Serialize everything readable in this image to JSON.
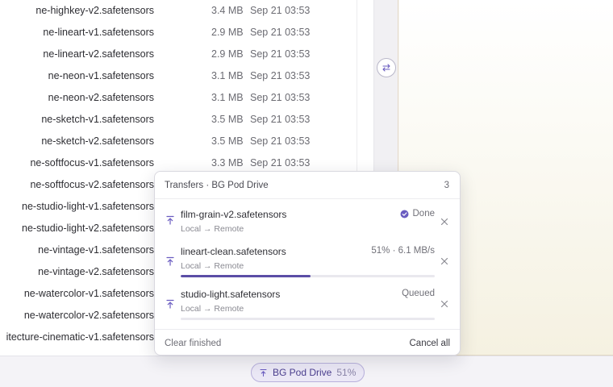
{
  "files": [
    {
      "name": "ne-highkey-v2.safetensors",
      "size": "3.4 MB",
      "date": "Sep 21 03:53"
    },
    {
      "name": "ne-lineart-v1.safetensors",
      "size": "2.9 MB",
      "date": "Sep 21 03:53"
    },
    {
      "name": "ne-lineart-v2.safetensors",
      "size": "2.9 MB",
      "date": "Sep 21 03:53"
    },
    {
      "name": "ne-neon-v1.safetensors",
      "size": "3.1 MB",
      "date": "Sep 21 03:53"
    },
    {
      "name": "ne-neon-v2.safetensors",
      "size": "3.1 MB",
      "date": "Sep 21 03:53"
    },
    {
      "name": "ne-sketch-v1.safetensors",
      "size": "3.5 MB",
      "date": "Sep 21 03:53"
    },
    {
      "name": "ne-sketch-v2.safetensors",
      "size": "3.5 MB",
      "date": "Sep 21 03:53"
    },
    {
      "name": "ne-softfocus-v1.safetensors",
      "size": "3.3 MB",
      "date": "Sep 21 03:53"
    },
    {
      "name": "ne-softfocus-v2.safetensors",
      "size": "",
      "date": ""
    },
    {
      "name": "ne-studio-light-v1.safetensors",
      "size": "",
      "date": ""
    },
    {
      "name": "ne-studio-light-v2.safetensors",
      "size": "",
      "date": ""
    },
    {
      "name": "ne-vintage-v1.safetensors",
      "size": "",
      "date": ""
    },
    {
      "name": "ne-vintage-v2.safetensors",
      "size": "",
      "date": ""
    },
    {
      "name": "ne-watercolor-v1.safetensors",
      "size": "",
      "date": ""
    },
    {
      "name": "ne-watercolor-v2.safetensors",
      "size": "",
      "date": ""
    },
    {
      "name": "itecture-cinematic-v1.safetensors",
      "size": "",
      "date": ""
    }
  ],
  "transfers": {
    "title": "Transfers · BG Pod Drive",
    "count": "3",
    "items": [
      {
        "name": "film-grain-v2.safetensors",
        "route": "Local → Remote",
        "status": "Done",
        "done": true,
        "progress": null
      },
      {
        "name": "lineart-clean.safetensors",
        "route": "Local → Remote",
        "status": "51% · 6.1 MB/s",
        "done": false,
        "progress": 0.51
      },
      {
        "name": "studio-light.safetensors",
        "route": "Local → Remote",
        "status": "Queued",
        "done": false,
        "progress": 0
      }
    ],
    "clear_label": "Clear finished",
    "cancel_label": "Cancel all"
  },
  "status_pill": {
    "label": "BG Pod Drive",
    "percent": "51%"
  },
  "colors": {
    "accent": "#5b4ea6",
    "accent_light": "#ebe8f6",
    "done_badge": "#6a5cc0"
  },
  "icons": {
    "transfer": "upload-arrow-icon",
    "swap": "swap-icon",
    "close": "close-icon",
    "done": "check-circle-icon"
  }
}
